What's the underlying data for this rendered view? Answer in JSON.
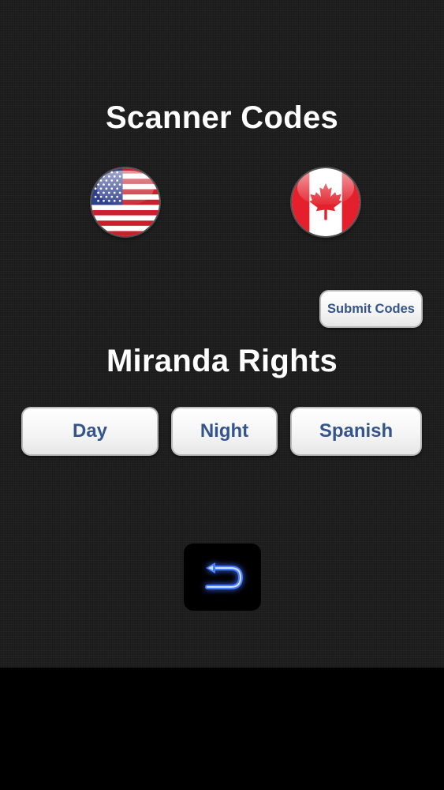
{
  "scanner_codes": {
    "title": "Scanner Codes",
    "flags": [
      {
        "name": "united-states-flag",
        "icon": "us-flag-icon"
      },
      {
        "name": "canada-flag",
        "icon": "canada-flag-icon"
      }
    ],
    "submit_label": "Submit Codes"
  },
  "miranda_rights": {
    "title": "Miranda Rights",
    "buttons": {
      "day": "Day",
      "night": "Night",
      "spanish": "Spanish"
    }
  },
  "navigation": {
    "back_icon": "back-arrow-icon"
  },
  "colors": {
    "background": "#1e1e1e",
    "button_text": "#34548c",
    "back_icon_glow": "#3a6cff",
    "heading_text": "#ffffff"
  }
}
